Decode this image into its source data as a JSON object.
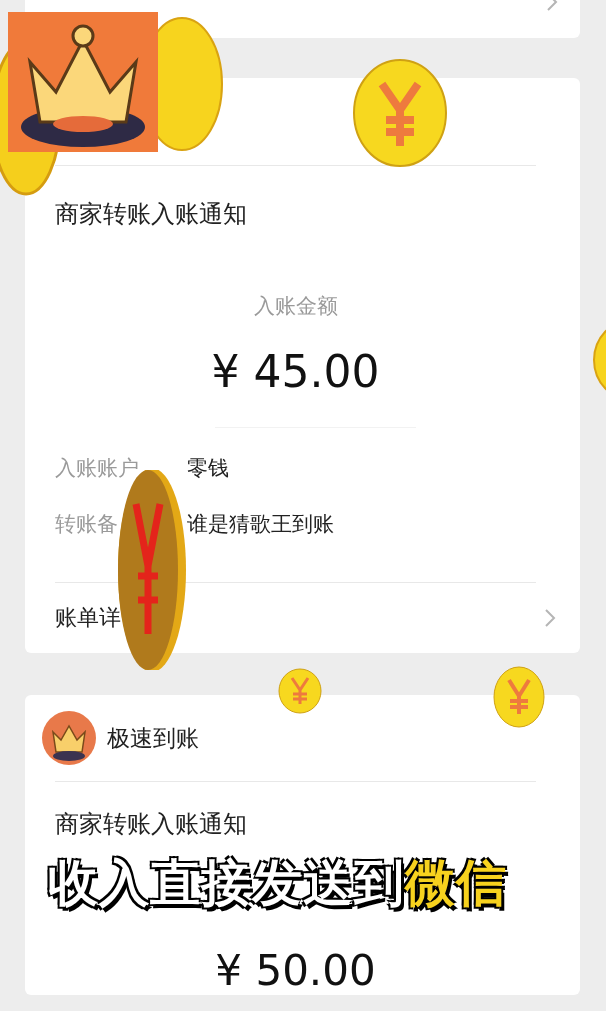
{
  "notice_cards": [
    {
      "title": "商家转账入账通知",
      "amount_label": "入账金额",
      "amount": "¥ 45.00",
      "fields": [
        {
          "label": "入账账户",
          "value": "零钱"
        },
        {
          "label": "转账备",
          "value": "谁是猜歌王到账"
        }
      ],
      "detail_link": "账单详"
    },
    {
      "sender": "极速到账",
      "title": "商家转账入账通知",
      "amount": "¥ 50.00"
    }
  ],
  "caption": {
    "text": "收入直接发送到",
    "highlight": "微信"
  }
}
